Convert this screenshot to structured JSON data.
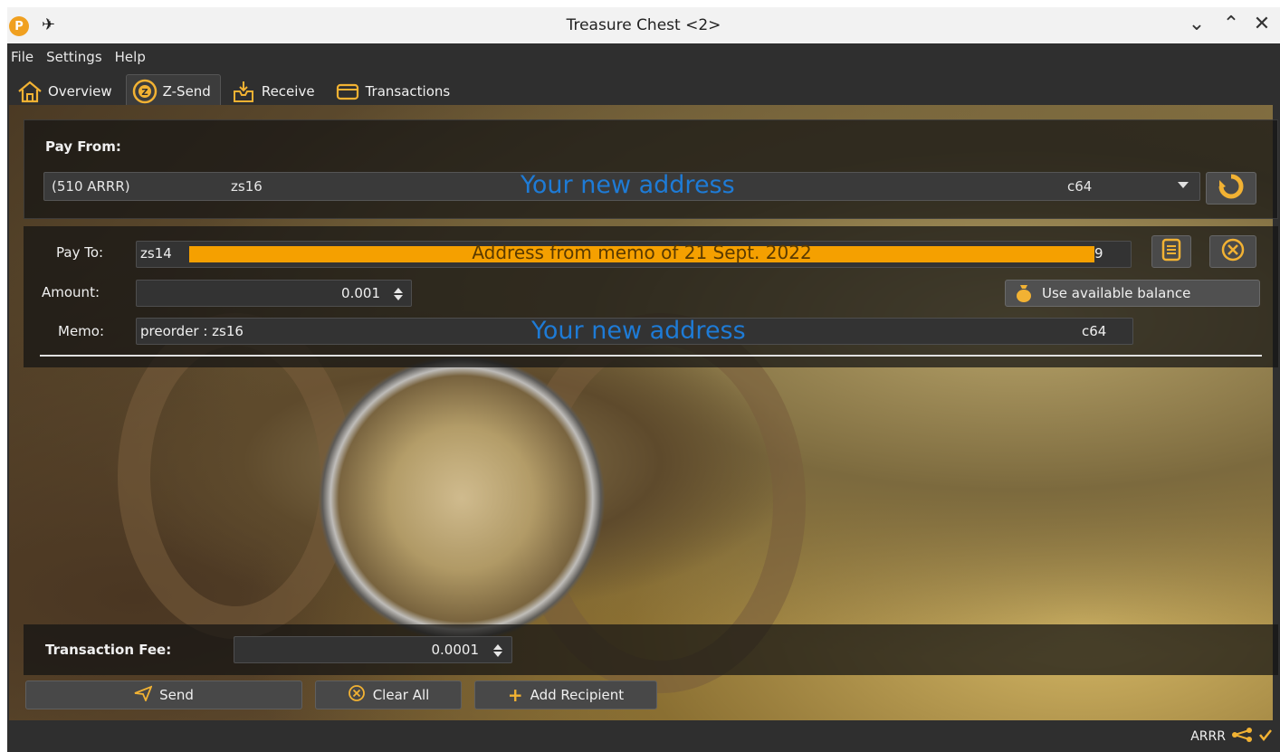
{
  "window": {
    "title": "Treasure Chest <2>",
    "app_icon_letter": "P"
  },
  "menu": {
    "file": "File",
    "settings": "Settings",
    "help": "Help"
  },
  "toolbar": {
    "overview": "Overview",
    "zsend": "Z-Send",
    "receive": "Receive",
    "transactions": "Transactions"
  },
  "pay_from": {
    "label": "Pay From:",
    "balance": "(510 ARRR)",
    "address_start": "zs16",
    "address_overlay": "Your new address",
    "address_end": "c64"
  },
  "pay_to": {
    "label": "Pay To:",
    "address_start": "zs14",
    "address_overlay": "Address from memo of 21 Sept. 2022",
    "address_end": "9"
  },
  "amount": {
    "label": "Amount:",
    "value": "0.001",
    "use_available_label": "Use available balance"
  },
  "memo": {
    "label": "Memo:",
    "prefix": "preorder : zs16",
    "overlay": "Your new address",
    "end": "c64"
  },
  "fee": {
    "label": "Transaction Fee:",
    "value": "0.0001"
  },
  "actions": {
    "send": "Send",
    "clear_all": "Clear All",
    "add_recipient": "Add Recipient"
  },
  "status": {
    "currency": "ARRR"
  },
  "colors": {
    "accent": "#f2b233",
    "highlight_orange": "#f5a000",
    "overlay_blue": "#1e7bd6"
  }
}
